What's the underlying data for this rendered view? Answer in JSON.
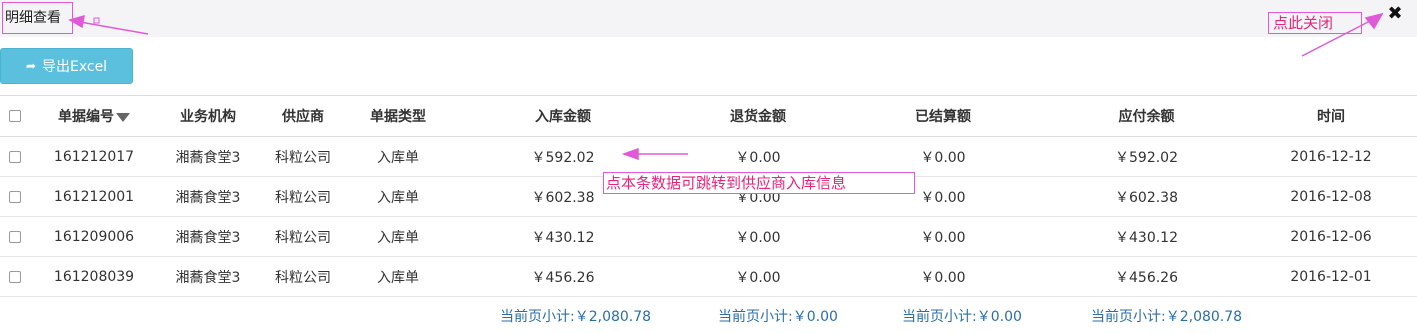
{
  "dialog": {
    "title": "明细查看",
    "close_glyph": "✖"
  },
  "annotations": {
    "close_hint": "点此关闭",
    "row_hint": "点本条数据可跳转到供应商入库信息",
    "color": "#e8247c"
  },
  "toolbar": {
    "export_label": "导出Excel",
    "export_icon": "export-icon",
    "accent": "#5bc0de"
  },
  "table": {
    "headers": {
      "doc_no": "单据编号",
      "org": "业务机构",
      "supplier": "供应商",
      "doc_type": "单据类型",
      "in_amount": "入库金额",
      "return_amount": "退货金额",
      "settled": "已结算额",
      "payable": "应付余额",
      "time": "时间"
    },
    "rows": [
      {
        "doc_no": "161212017",
        "org": "湘蕎食堂3",
        "supplier": "科粒公司",
        "doc_type": "入库单",
        "in_amount": "￥592.02",
        "return_amount": "￥0.00",
        "settled": "￥0.00",
        "payable": "￥592.02",
        "time": "2016-12-12"
      },
      {
        "doc_no": "161212001",
        "org": "湘蕎食堂3",
        "supplier": "科粒公司",
        "doc_type": "入库单",
        "in_amount": "￥602.38",
        "return_amount": "￥0.00",
        "settled": "￥0.00",
        "payable": "￥602.38",
        "time": "2016-12-08"
      },
      {
        "doc_no": "161209006",
        "org": "湘蕎食堂3",
        "supplier": "科粒公司",
        "doc_type": "入库单",
        "in_amount": "￥430.12",
        "return_amount": "￥0.00",
        "settled": "￥0.00",
        "payable": "￥430.12",
        "time": "2016-12-06"
      },
      {
        "doc_no": "161208039",
        "org": "湘蕎食堂3",
        "supplier": "科粒公司",
        "doc_type": "入库单",
        "in_amount": "￥456.26",
        "return_amount": "￥0.00",
        "settled": "￥0.00",
        "payable": "￥456.26",
        "time": "2016-12-01"
      }
    ]
  },
  "summary": {
    "in_amount": "当前页小计:￥2,080.78",
    "return_amount": "当前页小计:￥0.00",
    "settled": "当前页小计:￥0.00",
    "payable": "当前页小计:￥2,080.78"
  }
}
